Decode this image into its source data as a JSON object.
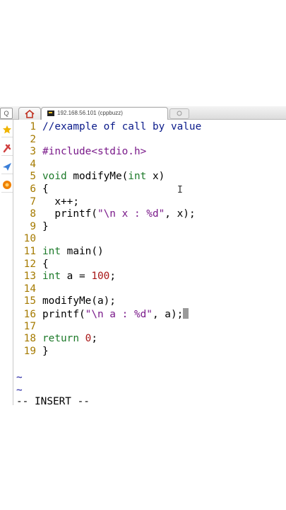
{
  "browser": {
    "tab_title": "192.168.56.101 (cppbuzz)",
    "left_stub": "Q"
  },
  "sidebar": {
    "items": [
      {
        "icon": "star-icon",
        "color": "#f0b400"
      },
      {
        "icon": "tools-icon",
        "color": "#d04040"
      },
      {
        "icon": "paper-plane-icon",
        "color": "#3a7ed8"
      },
      {
        "icon": "orange-badge-icon",
        "color": "#f08000"
      }
    ]
  },
  "editor": {
    "lines": [
      {
        "n": "1",
        "tokens": [
          {
            "t": "//example of call by value",
            "c": "comment"
          }
        ]
      },
      {
        "n": "2",
        "tokens": []
      },
      {
        "n": "3",
        "tokens": [
          {
            "t": "#include",
            "c": "pre"
          },
          {
            "t": "<stdio.h>",
            "c": "pre"
          }
        ]
      },
      {
        "n": "4",
        "tokens": []
      },
      {
        "n": "5",
        "tokens": [
          {
            "t": "void",
            "c": "type"
          },
          {
            "t": " modifyMe(",
            "c": "plain"
          },
          {
            "t": "int",
            "c": "type"
          },
          {
            "t": " x)",
            "c": "plain"
          }
        ]
      },
      {
        "n": "6",
        "tokens": [
          {
            "t": "{",
            "c": "plain"
          }
        ]
      },
      {
        "n": "7",
        "tokens": [
          {
            "t": "  x++;",
            "c": "plain"
          }
        ]
      },
      {
        "n": "8",
        "tokens": [
          {
            "t": "  printf(",
            "c": "plain"
          },
          {
            "t": "\"\\n x : %d\"",
            "c": "str"
          },
          {
            "t": ", x);",
            "c": "plain"
          }
        ]
      },
      {
        "n": "9",
        "tokens": [
          {
            "t": "}",
            "c": "plain"
          }
        ]
      },
      {
        "n": "10",
        "tokens": []
      },
      {
        "n": "11",
        "tokens": [
          {
            "t": "int",
            "c": "type"
          },
          {
            "t": " main()",
            "c": "plain"
          }
        ]
      },
      {
        "n": "12",
        "tokens": [
          {
            "t": "{",
            "c": "plain"
          }
        ]
      },
      {
        "n": "13",
        "tokens": [
          {
            "t": "int",
            "c": "type"
          },
          {
            "t": " a = ",
            "c": "plain"
          },
          {
            "t": "100",
            "c": "num"
          },
          {
            "t": ";",
            "c": "plain"
          }
        ]
      },
      {
        "n": "14",
        "tokens": []
      },
      {
        "n": "15",
        "tokens": [
          {
            "t": "modifyMe(a);",
            "c": "plain"
          }
        ]
      },
      {
        "n": "16",
        "tokens": [
          {
            "t": "printf(",
            "c": "plain"
          },
          {
            "t": "\"\\n a : %d\"",
            "c": "str"
          },
          {
            "t": ", a);",
            "c": "plain"
          }
        ],
        "cursor": true
      },
      {
        "n": "17",
        "tokens": []
      },
      {
        "n": "18",
        "tokens": [
          {
            "t": "return",
            "c": "type"
          },
          {
            "t": " ",
            "c": "plain"
          },
          {
            "t": "0",
            "c": "num"
          },
          {
            "t": ";",
            "c": "plain"
          }
        ]
      },
      {
        "n": "19",
        "tokens": [
          {
            "t": "}",
            "c": "plain"
          }
        ]
      }
    ],
    "tilde": "~",
    "mode_text": "-- INSERT --"
  }
}
